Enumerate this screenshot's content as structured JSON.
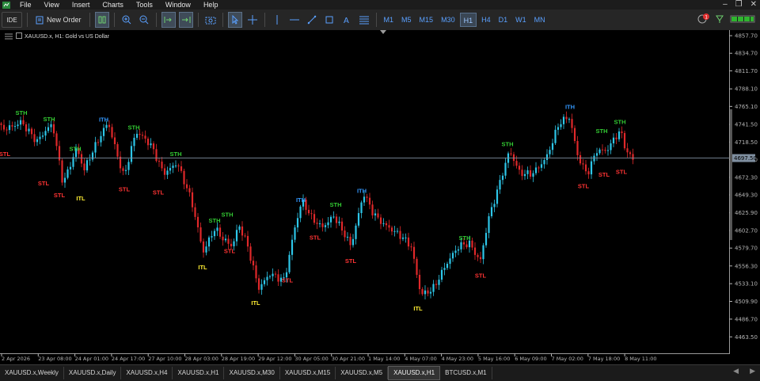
{
  "menu": [
    "File",
    "View",
    "Insert",
    "Charts",
    "Tools",
    "Window",
    "Help"
  ],
  "toolbar": {
    "ide_label": "IDE",
    "new_order_label": "New Order",
    "timeframes": [
      "M1",
      "M5",
      "M15",
      "M30",
      "H1",
      "H4",
      "D1",
      "W1",
      "MN"
    ],
    "active_timeframe": "H1",
    "notification_count": "1"
  },
  "chart_header": {
    "symbol_label": "XAUUSD.x, H1:  Gold vs US Dollar"
  },
  "current_price": "4697.50",
  "colors": {
    "bull": "#2dc6e8",
    "bear": "#e0282a",
    "sth": "#33cc33",
    "stl": "#ff3333",
    "ith": "#3399ff",
    "itl": "#ffee33",
    "axis": "#b4b4b4",
    "price_line": "#7f8fa0"
  },
  "chart_data": {
    "type": "candlestick",
    "y_range": [
      4442,
      4865
    ],
    "price_ticks": [
      "4857.70",
      "4834.70",
      "4811.70",
      "4788.10",
      "4765.10",
      "4741.50",
      "4718.50",
      "4695.50",
      "4672.30",
      "4649.30",
      "4625.90",
      "4602.70",
      "4579.70",
      "4556.30",
      "4533.10",
      "4509.90",
      "4486.70",
      "4463.50"
    ],
    "time_ticks": [
      "2 Apr 2026",
      "23 Apr 08:00",
      "24 Apr 01:00",
      "24 Apr 17:00",
      "27 Apr 10:00",
      "28 Apr 03:00",
      "28 Apr 19:00",
      "29 Apr 12:00",
      "30 Apr 05:00",
      "30 Apr 21:00",
      "1 May 14:00",
      "4 May 07:00",
      "4 May 23:00",
      "5 May 16:00",
      "6 May 09:00",
      "7 May 02:00",
      "7 May 18:00",
      "8 May 11:00"
    ],
    "key_points": [
      [
        0,
        4736
      ],
      [
        25,
        4748
      ],
      [
        45,
        4715
      ],
      [
        65,
        4742
      ],
      [
        78,
        4668
      ],
      [
        95,
        4712
      ],
      [
        105,
        4680
      ],
      [
        120,
        4712
      ],
      [
        135,
        4746
      ],
      [
        155,
        4676
      ],
      [
        170,
        4730
      ],
      [
        190,
        4710
      ],
      [
        205,
        4680
      ],
      [
        222,
        4695
      ],
      [
        240,
        4640
      ],
      [
        255,
        4571
      ],
      [
        270,
        4608
      ],
      [
        282,
        4594
      ],
      [
        292,
        4584
      ],
      [
        300,
        4609
      ],
      [
        310,
        4583
      ],
      [
        325,
        4525
      ],
      [
        340,
        4550
      ],
      [
        358,
        4540
      ],
      [
        370,
        4600
      ],
      [
        380,
        4638
      ],
      [
        392,
        4618
      ],
      [
        405,
        4610
      ],
      [
        420,
        4625
      ],
      [
        432,
        4600
      ],
      [
        442,
        4578
      ],
      [
        458,
        4650
      ],
      [
        470,
        4628
      ],
      [
        490,
        4608
      ],
      [
        505,
        4592
      ],
      [
        518,
        4578
      ],
      [
        530,
        4520
      ],
      [
        545,
        4530
      ],
      [
        560,
        4555
      ],
      [
        578,
        4578
      ],
      [
        592,
        4585
      ],
      [
        605,
        4565
      ],
      [
        615,
        4620
      ],
      [
        630,
        4665
      ],
      [
        642,
        4703
      ],
      [
        655,
        4676
      ],
      [
        670,
        4680
      ],
      [
        690,
        4702
      ],
      [
        705,
        4740
      ],
      [
        718,
        4748
      ],
      [
        728,
        4702
      ],
      [
        740,
        4680
      ],
      [
        752,
        4710
      ],
      [
        765,
        4705
      ],
      [
        782,
        4730
      ],
      [
        790,
        4705
      ],
      [
        800,
        4697
      ]
    ],
    "swing_labels": [
      {
        "text": "STH",
        "type": "STH",
        "x": 27,
        "price": 4754
      },
      {
        "text": "STH",
        "type": "STH",
        "x": 62,
        "price": 4746
      },
      {
        "text": "STH",
        "type": "STH",
        "x": 95,
        "price": 4707
      },
      {
        "text": "ITH",
        "type": "ITH",
        "x": 131,
        "price": 4745
      },
      {
        "text": "STH",
        "type": "STH",
        "x": 169,
        "price": 4735
      },
      {
        "text": "STH",
        "type": "STH",
        "x": 222,
        "price": 4700
      },
      {
        "text": "STH",
        "type": "STH",
        "x": 271,
        "price": 4613
      },
      {
        "text": "STH",
        "type": "STH",
        "x": 287,
        "price": 4621
      },
      {
        "text": "ITH",
        "type": "ITH",
        "x": 380,
        "price": 4640
      },
      {
        "text": "STH",
        "type": "STH",
        "x": 424,
        "price": 4634
      },
      {
        "text": "ITH",
        "type": "ITH",
        "x": 457,
        "price": 4652
      },
      {
        "text": "STH",
        "type": "STH",
        "x": 587,
        "price": 4590
      },
      {
        "text": "STH",
        "type": "STH",
        "x": 641,
        "price": 4713
      },
      {
        "text": "ITH",
        "type": "ITH",
        "x": 720,
        "price": 4762
      },
      {
        "text": "STH",
        "type": "STH",
        "x": 760,
        "price": 4730
      },
      {
        "text": "STH",
        "type": "STH",
        "x": 783,
        "price": 4742
      },
      {
        "text": "STL",
        "type": "STL",
        "x": 6,
        "price": 4700
      },
      {
        "text": "STL",
        "type": "STL",
        "x": 55,
        "price": 4662
      },
      {
        "text": "STL",
        "type": "STL",
        "x": 75,
        "price": 4646
      },
      {
        "text": "ITL",
        "type": "ITL",
        "x": 102,
        "price": 4642
      },
      {
        "text": "STL",
        "type": "STL",
        "x": 157,
        "price": 4654
      },
      {
        "text": "STL",
        "type": "STL",
        "x": 200,
        "price": 4650
      },
      {
        "text": "ITL",
        "type": "ITL",
        "x": 256,
        "price": 4552
      },
      {
        "text": "STL",
        "type": "STL",
        "x": 290,
        "price": 4573
      },
      {
        "text": "ITL",
        "type": "ITL",
        "x": 323,
        "price": 4505
      },
      {
        "text": "STL",
        "type": "STL",
        "x": 363,
        "price": 4535
      },
      {
        "text": "STL",
        "type": "STL",
        "x": 398,
        "price": 4591
      },
      {
        "text": "STL",
        "type": "STL",
        "x": 443,
        "price": 4560
      },
      {
        "text": "ITL",
        "type": "ITL",
        "x": 528,
        "price": 4498
      },
      {
        "text": "STL",
        "type": "STL",
        "x": 607,
        "price": 4541
      },
      {
        "text": "STL",
        "type": "STL",
        "x": 737,
        "price": 4658
      },
      {
        "text": "STL",
        "type": "STL",
        "x": 763,
        "price": 4673
      },
      {
        "text": "STL",
        "type": "STL",
        "x": 785,
        "price": 4677
      }
    ]
  },
  "tabs": [
    "XAUUSD.x,Weekly",
    "XAUUSD.x,Daily",
    "XAUUSD.x,H4",
    "XAUUSD.x,H1",
    "XAUUSD.x,M30",
    "XAUUSD.x,M15",
    "XAUUSD.x,M5",
    "XAUUSD.x,H1",
    "BTCUSD.x,M1"
  ],
  "active_tab_index": 7
}
